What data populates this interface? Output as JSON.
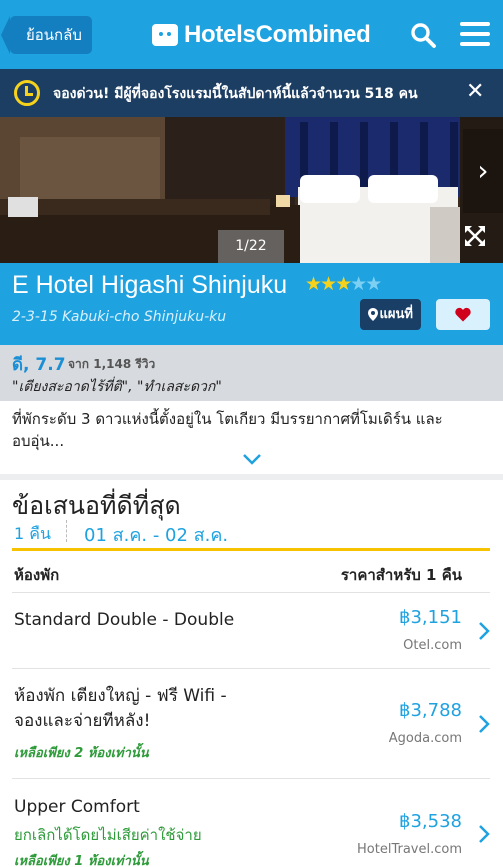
{
  "header": {
    "back_label": "ย้อนกลับ",
    "logo_text": "HotelsCombined"
  },
  "urgency": {
    "text": "จองด่วน! มีผู้ที่จองโรงแรมนี้ในสัปดาห์นี้แล้วจำนวน 518 คน",
    "close": "✕"
  },
  "photo": {
    "counter": "1/22",
    "next": "›"
  },
  "hotel": {
    "name": "E Hotel Higashi Shinjuku",
    "rating_stars": 3,
    "max_stars": 5,
    "address": "2-3-15 Kabuki-cho Shinjuku-ku",
    "map_label": "แผนที่"
  },
  "review": {
    "score": "ดี, 7.7",
    "count": "จาก 1,148 รีวิว",
    "quotes": "\"เตียงสะอาดไร้ที่ติ\", \"ทำเลสะดวก\""
  },
  "description": "ที่พักระดับ 3 ดาวแห่งนี้ตั้งอยู่ใน โตเกียว มีบรรยากาศที่โมเดิร์น และอบอุ่น...",
  "deals": {
    "title": "ข้อเสนอที่ดีที่สุด",
    "nights": "1 คืน",
    "dates": "01 ส.ค. - 02 ส.ค.",
    "col_room": "ห้องพัก",
    "col_price": "ราคาสำหรับ 1 คืน",
    "rooms": [
      {
        "name": "Standard Double - Double",
        "price": "฿3,151",
        "provider": "Otel.com"
      },
      {
        "name": "ห้องพัก เตียงใหญ่ - ฟรี Wifi - จองและจ่ายทีหลัง!",
        "note": "เหลือเพียง 2 ห้องเท่านั้น",
        "price": "฿3,788",
        "provider": "Agoda.com"
      },
      {
        "name": "Upper Comfort",
        "cancel": "ยกเลิกได้โดยไม่เสียค่าใช้จ่าย",
        "note": "เหลือเพียง 1 ห้องเท่านั้น",
        "price": "฿3,538",
        "provider": "HotelTravel.com"
      }
    ]
  },
  "colors": {
    "brand_blue": "#1fa2e0",
    "banner_navy": "#1d3e63",
    "star_yellow": "#f7d21b",
    "accent_yellow": "#f7c200",
    "available_green": "#2e9b3a",
    "heart_red": "#d0021b"
  },
  "icons": [
    "search-icon",
    "menu-icon",
    "clock-icon",
    "close-icon",
    "chevron-right-icon",
    "expand-icon",
    "pin-icon",
    "heart-icon",
    "chevron-down-icon"
  ]
}
